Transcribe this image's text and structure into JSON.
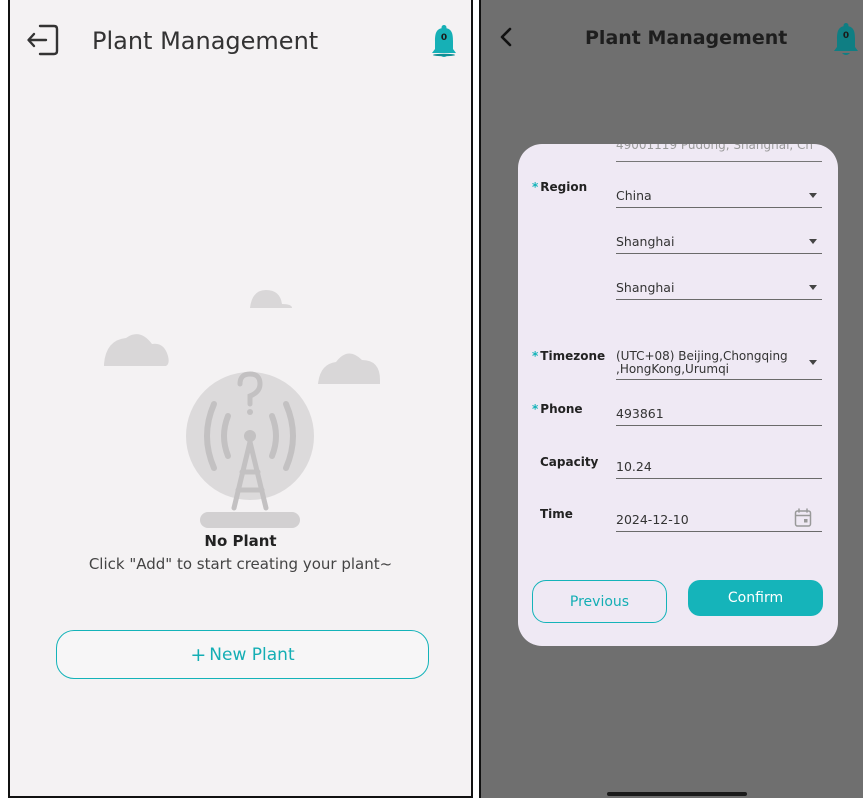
{
  "left_screen": {
    "header": {
      "title": "Plant Management",
      "notification_count": "0"
    },
    "empty_state": {
      "title": "No Plant",
      "subtitle": "Click \"Add\" to start creating your plant~"
    },
    "new_plant_button": {
      "icon": "+",
      "label": "New Plant"
    }
  },
  "right_screen": {
    "header": {
      "title": "Plant Management",
      "notification_count": "0"
    },
    "form": {
      "address_partial": "49001119 Pudong, Shanghai, Ch",
      "region": {
        "label": "Region",
        "country": "China",
        "province": "Shanghai",
        "city": "Shanghai"
      },
      "timezone": {
        "label": "Timezone",
        "value": "(UTC+08) Beijing,Chongqing ,HongKong,Urumqi"
      },
      "phone": {
        "label": "Phone",
        "value": "493861"
      },
      "capacity": {
        "label": "Capacity",
        "value": "10.24"
      },
      "time": {
        "label": "Time",
        "value": "2024-12-10"
      },
      "buttons": {
        "previous": "Previous",
        "confirm": "Confirm"
      }
    }
  },
  "colors": {
    "accent": "#14b3b9",
    "left_background": "#f4f2f3",
    "overlay": "#6f6f6f",
    "modal_background": "#efe9f4"
  }
}
